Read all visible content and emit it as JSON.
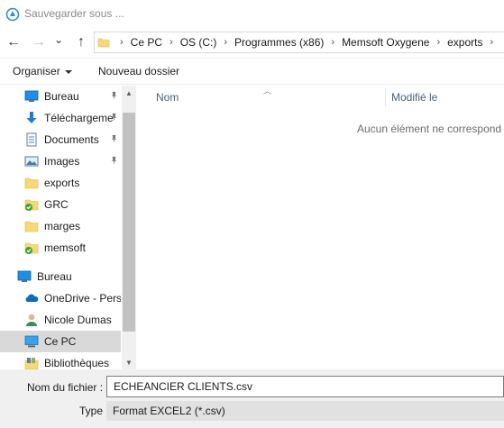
{
  "window": {
    "title": "Sauvegarder sous ..."
  },
  "navigation": {
    "back_glyph": "←",
    "forward_glyph": "→",
    "recent_glyph": "⌄",
    "up_glyph": "↑"
  },
  "address": {
    "breadcrumbs": [
      "Ce PC",
      "OS (C:)",
      "Programmes (x86)",
      "Memsoft Oxygene",
      "exports"
    ],
    "separator": "›"
  },
  "toolbar": {
    "organize_label": "Organiser",
    "new_folder_label": "Nouveau dossier"
  },
  "sidebar": {
    "items": [
      {
        "label": "Bureau",
        "icon": "desktop-icon",
        "pinned": true
      },
      {
        "label": "Téléchargeme",
        "icon": "download-icon",
        "pinned": true
      },
      {
        "label": "Documents",
        "icon": "documents-icon",
        "pinned": true
      },
      {
        "label": "Images",
        "icon": "images-icon",
        "pinned": true
      },
      {
        "label": "exports",
        "icon": "folder-icon",
        "pinned": false
      },
      {
        "label": "GRC",
        "icon": "folder-synced-icon",
        "pinned": false
      },
      {
        "label": "marges",
        "icon": "folder-icon",
        "pinned": false
      },
      {
        "label": "memsoft",
        "icon": "folder-synced-icon",
        "pinned": false
      },
      {
        "label": "Bureau",
        "icon": "desktop-icon",
        "pinned": false
      },
      {
        "label": "OneDrive - Perso",
        "icon": "onedrive-icon",
        "pinned": false
      },
      {
        "label": "Nicole Dumas",
        "icon": "user-icon",
        "pinned": false
      },
      {
        "label": "Ce PC",
        "icon": "this-pc-icon",
        "pinned": false,
        "selected": true
      },
      {
        "label": "Bibliothèques",
        "icon": "libraries-icon",
        "pinned": false
      }
    ]
  },
  "content": {
    "columns": [
      "Nom",
      "Modifié le"
    ],
    "empty_message": "Aucun élément ne correspond"
  },
  "form": {
    "filename_label": "Nom du fichier :",
    "filename_value": "ECHEANCIER CLIENTS.csv",
    "type_label": "Type :",
    "type_value": "Format EXCEL2 (*.csv)"
  },
  "colors": {
    "accent": "#0078d7",
    "folder_yellow": "#f8d775",
    "sync_green": "#3aa335",
    "selected_bg": "#d9d9d9"
  }
}
